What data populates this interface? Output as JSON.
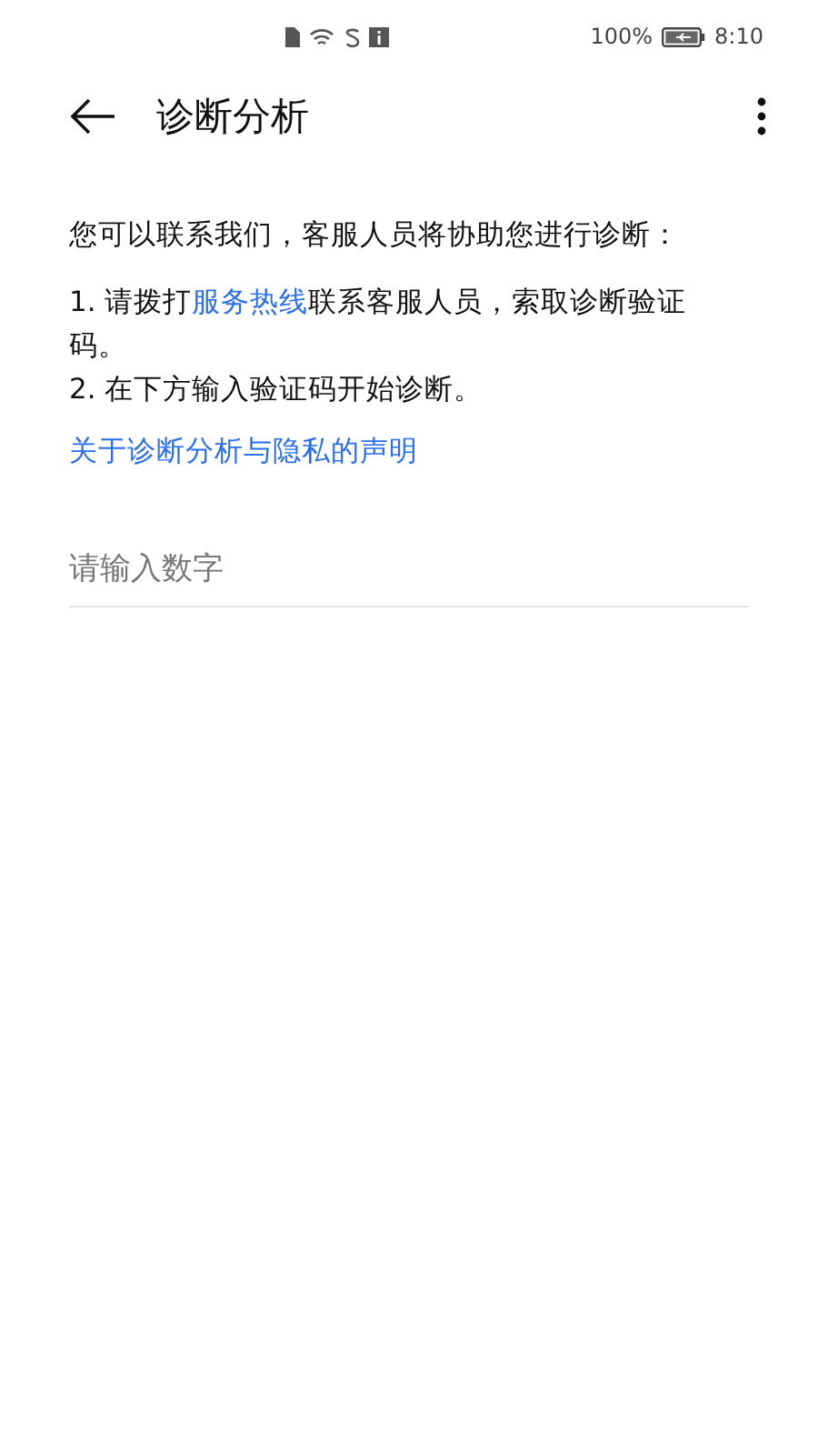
{
  "status_bar": {
    "battery": "100%",
    "time": "8:10"
  },
  "app_bar": {
    "title": "诊断分析"
  },
  "intro": "您可以联系我们，客服人员将协助您进行诊断：",
  "steps": [
    {
      "before": "1. 请拨打",
      "link": "服务热线",
      "after": "联系客服人员，索取诊断验证码。"
    },
    {
      "before": "2. 在下方输入验证码开始诊断。"
    }
  ],
  "privacy_link": "关于诊断分析与隐私的声明",
  "code_field": {
    "placeholder": "请输入数字"
  }
}
